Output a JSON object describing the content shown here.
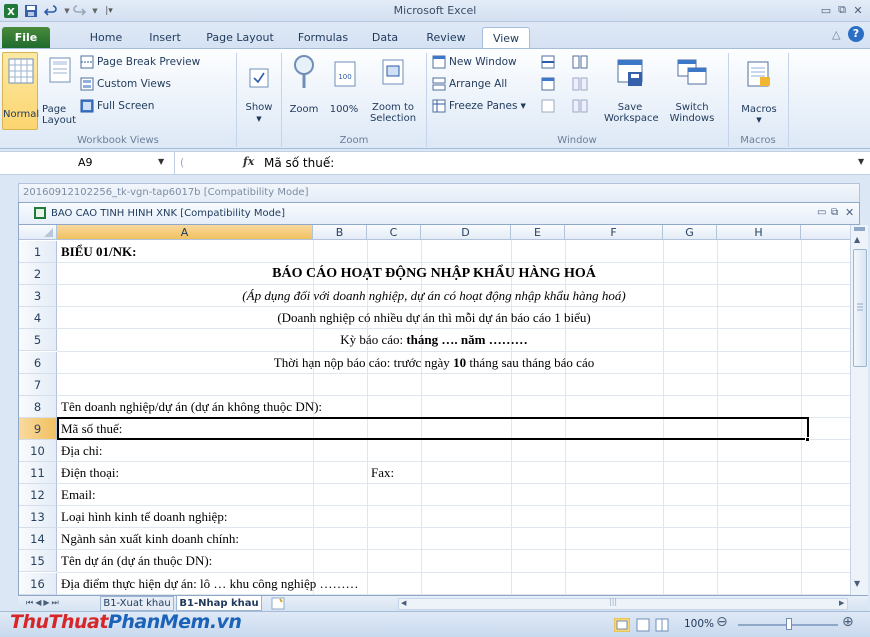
{
  "app": {
    "title": "Microsoft Excel"
  },
  "tabs": [
    "File",
    "Home",
    "Insert",
    "Page Layout",
    "Formulas",
    "Data",
    "Review",
    "View"
  ],
  "ribbon": {
    "workbook_views": {
      "normal": "Normal",
      "page_layout": "Page\nLayout",
      "page_break_preview": "Page Break Preview",
      "custom_views": "Custom Views",
      "full_screen": "Full Screen",
      "group_label": "Workbook Views"
    },
    "show": {
      "label": "Show"
    },
    "zoom": {
      "zoom": "Zoom",
      "hundred": "100%",
      "zoom_to_selection": "Zoom to\nSelection",
      "group_label": "Zoom"
    },
    "window": {
      "new_window": "New Window",
      "arrange_all": "Arrange All",
      "freeze_panes": "Freeze Panes",
      "save_workspace": "Save\nWorkspace",
      "switch_windows": "Switch\nWindows",
      "group_label": "Window"
    },
    "macros": {
      "label": "Macros",
      "group_label": "Macros"
    }
  },
  "formula_bar": {
    "name_box": "A9",
    "fx": "fx",
    "content": "Mã số thuế:"
  },
  "windows": {
    "background_title": "20160912102256_tk-vgn-tap6017b  [Compatibility Mode]",
    "active_title": "BAO CAO TINH HINH XNK  [Compatibility Mode]"
  },
  "columns": [
    "A",
    "B",
    "C",
    "D",
    "E",
    "F",
    "G",
    "H"
  ],
  "rows": [
    {
      "n": "1",
      "text": "BIỂU 01/NK:",
      "style": "bold"
    },
    {
      "n": "2",
      "text": "BÁO CÁO HOẠT ĐỘNG NHẬP KHẨU HÀNG HOÁ",
      "style": "center-bold"
    },
    {
      "n": "3",
      "text": "(Áp dụng đối với doanh nghiệp, dự án có hoạt động nhập khẩu hàng hoá)",
      "style": "center-italic"
    },
    {
      "n": "4",
      "text": "(Doanh nghiệp có nhiều dự án thì mỗi dự án báo cáo 1 biểu)",
      "style": "center"
    },
    {
      "n": "5",
      "text": "Kỳ báo cáo: ",
      "bold_tail": "tháng …. năm ………",
      "style": "center"
    },
    {
      "n": "6",
      "text": "Thời hạn nộp báo cáo: trước ngày ",
      "bold_mid": "10",
      "tail": " tháng sau tháng báo cáo",
      "style": "center"
    },
    {
      "n": "7",
      "text": "",
      "style": ""
    },
    {
      "n": "8",
      "text": "Tên doanh nghiệp/dự án (dự án không thuộc DN):",
      "style": ""
    },
    {
      "n": "9",
      "text": "Mã số thuế:",
      "style": ""
    },
    {
      "n": "10",
      "text": "Địa chỉ:",
      "style": ""
    },
    {
      "n": "11",
      "text": "Điện thoại:",
      "extra": "Fax:",
      "style": ""
    },
    {
      "n": "12",
      "text": "Email:",
      "style": ""
    },
    {
      "n": "13",
      "text": "Loại hình kinh tế doanh nghiệp:",
      "style": ""
    },
    {
      "n": "14",
      "text": "Ngành sản xuất kinh doanh chính:",
      "style": ""
    },
    {
      "n": "15",
      "text": "Tên dự án (dự án thuộc DN):",
      "style": ""
    },
    {
      "n": "16",
      "text": "Địa điểm thực hiện dự án: lô … khu công nghiệp ………",
      "style": ""
    }
  ],
  "selected_cell": "A9",
  "sheets": [
    "B1-Xuat khau",
    "B1-Nhap khau"
  ],
  "active_sheet": "B1-Nhap khau",
  "status": {
    "zoom": "100%"
  },
  "watermark": {
    "part1": "ThuThuat",
    "part2": "PhanMem",
    "part3": ".vn"
  },
  "colors": {
    "file_tab": "#2a7a37",
    "selection_header": "#f1c15f",
    "watermark_red": "#d6262a",
    "watermark_blue": "#1a63b8"
  }
}
